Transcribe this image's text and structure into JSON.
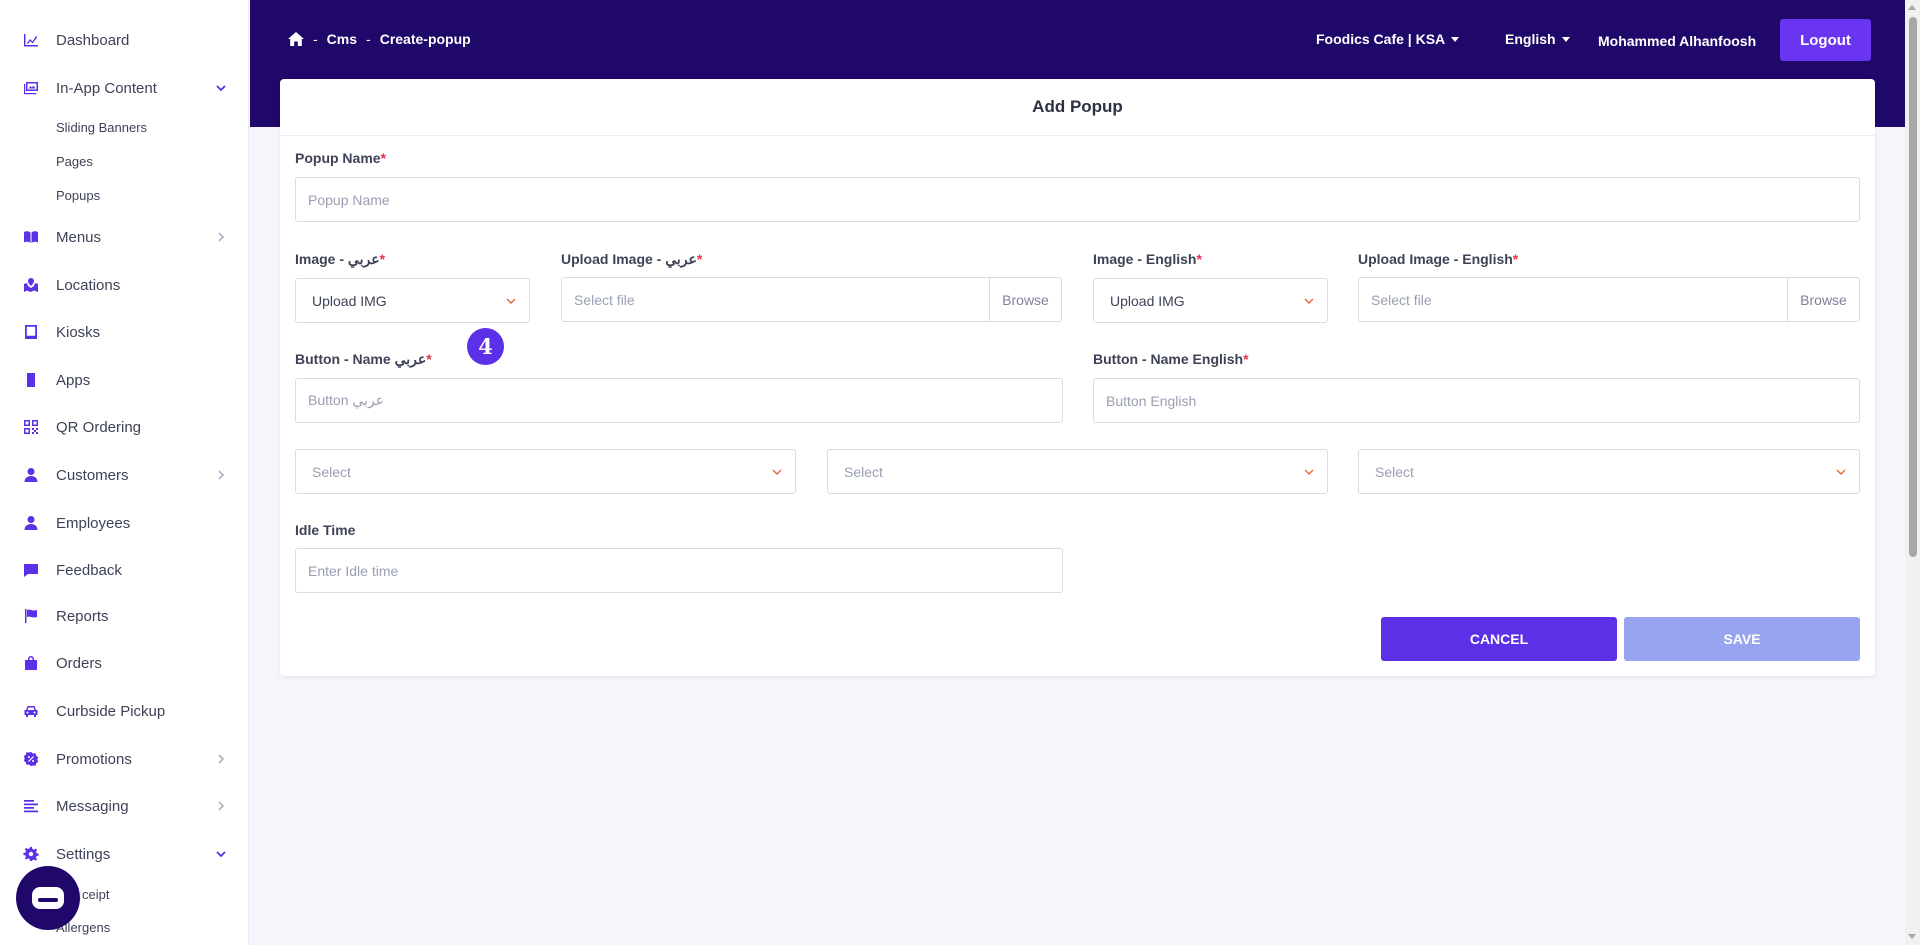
{
  "sidebar": {
    "items": [
      {
        "label": "Dashboard",
        "icon": "chart-area-icon"
      },
      {
        "label": "In-App Content",
        "icon": "images-icon",
        "expanded": true
      },
      {
        "label": "Menus",
        "icon": "book-icon"
      },
      {
        "label": "Locations",
        "icon": "map-marked-icon"
      },
      {
        "label": "Kiosks",
        "icon": "tablet-icon"
      },
      {
        "label": "Apps",
        "icon": "mobile-icon"
      },
      {
        "label": "QR Ordering",
        "icon": "qrcode-icon"
      },
      {
        "label": "Customers",
        "icon": "user-icon"
      },
      {
        "label": "Employees",
        "icon": "user-icon"
      },
      {
        "label": "Feedback",
        "icon": "comment-icon"
      },
      {
        "label": "Reports",
        "icon": "flag-icon"
      },
      {
        "label": "Orders",
        "icon": "shopping-bag-icon"
      },
      {
        "label": "Curbside Pickup",
        "icon": "car-icon"
      },
      {
        "label": "Promotions",
        "icon": "percent-badge-icon"
      },
      {
        "label": "Messaging",
        "icon": "align-left-icon"
      },
      {
        "label": "Settings",
        "icon": "gear-icon",
        "expanded": true
      }
    ],
    "in_app_sub": [
      "Sliding Banners",
      "Pages",
      "Popups"
    ],
    "settings_sub": [
      "Receipt",
      "Allergens"
    ],
    "settings_sub_visible": [
      "ceipt",
      "Allergens"
    ]
  },
  "header": {
    "breadcrumb": [
      "Cms",
      "Create-popup"
    ],
    "breadcrumb_sep": "-",
    "business": "Foodics Cafe | KSA",
    "language": "English",
    "user": "Mohammed Alhanfoosh",
    "logout": "Logout"
  },
  "form": {
    "title": "Add Popup",
    "popup_name": {
      "label": "Popup Name",
      "placeholder": "Popup Name"
    },
    "image_ar": {
      "label": "Image - عربي",
      "value": "Upload IMG"
    },
    "upload_ar": {
      "label": "Upload Image - عربي",
      "placeholder": "Select file",
      "browse": "Browse"
    },
    "image_en": {
      "label": "Image - English",
      "value": "Upload IMG"
    },
    "upload_en": {
      "label": "Upload Image - English",
      "placeholder": "Select file",
      "browse": "Browse"
    },
    "button_ar": {
      "label": "Button - Name عربي",
      "placeholder": "Button عربي"
    },
    "button_en": {
      "label": "Button - Name English",
      "placeholder": "Button English"
    },
    "selects": [
      "Select",
      "Select",
      "Select"
    ],
    "idle_time": {
      "label": "Idle Time",
      "placeholder": "Enter Idle time"
    },
    "required_mark": "*",
    "cancel": "CANCEL",
    "save": "SAVE"
  },
  "step_badge": "4",
  "colors": {
    "brand_dark": "#20076a",
    "accent": "#5b30e6",
    "save_disabled": "#98a4ef",
    "required": "#e0344a",
    "chevron": "#e0693a"
  }
}
